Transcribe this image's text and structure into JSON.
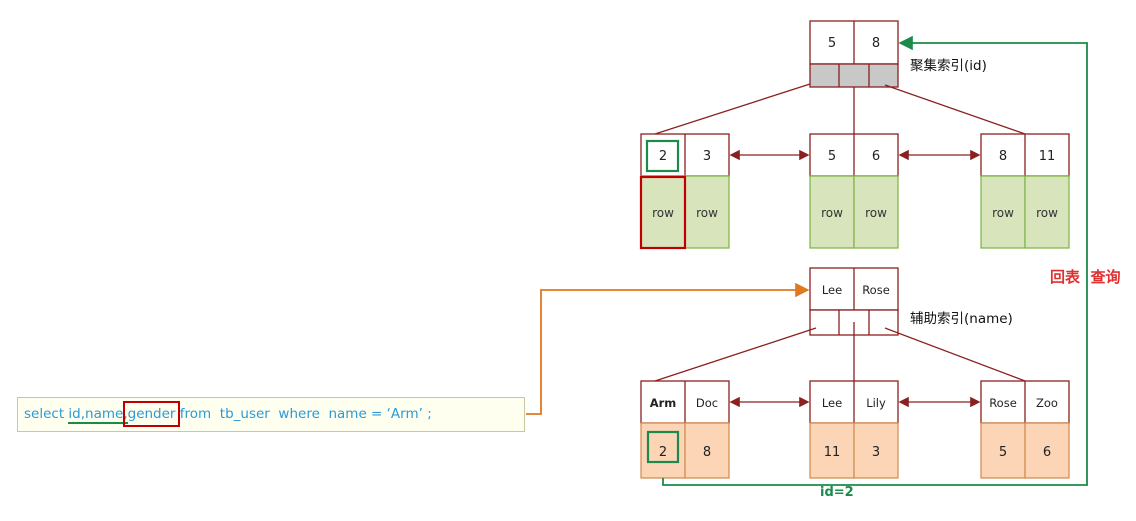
{
  "clustered_index": {
    "label": "聚集索引(id)",
    "root_keys": [
      "5",
      "8"
    ],
    "leaves": [
      {
        "keys": [
          "2",
          "3"
        ],
        "rows": [
          "row",
          "row"
        ]
      },
      {
        "keys": [
          "5",
          "6"
        ],
        "rows": [
          "row",
          "row"
        ]
      },
      {
        "keys": [
          "8",
          "11"
        ],
        "rows": [
          "row",
          "row"
        ]
      }
    ]
  },
  "secondary_index": {
    "label": "辅助索引(name)",
    "root_keys": [
      "Lee",
      "Rose"
    ],
    "leaves": [
      {
        "keys": [
          "Arm",
          "Doc"
        ],
        "values": [
          "2",
          "8"
        ]
      },
      {
        "keys": [
          "Lee",
          "Lily"
        ],
        "values": [
          "11",
          "3"
        ]
      },
      {
        "keys": [
          "Rose",
          "Zoo"
        ],
        "values": [
          "5",
          "6"
        ]
      }
    ]
  },
  "sql": {
    "select_kw": "select",
    "cols": "id,name,",
    "gender": "gender",
    "rest": " from  tb_user  where  name = ‘Arm’ ;"
  },
  "back_query_label": "回表  查询",
  "id_label": "id=2",
  "colors": {
    "node_border": "#8b2020",
    "green_fill": "#d8e4bc",
    "green_border": "#7cb342",
    "orange_fill": "#fbd5b5",
    "orange_border": "#d08a4a",
    "gray_fill": "#c8c8c8",
    "highlight_red": "#c00000",
    "highlight_green": "#1b8a4a",
    "orange_line": "#e07820",
    "sql_blue": "#2b9ad6"
  }
}
